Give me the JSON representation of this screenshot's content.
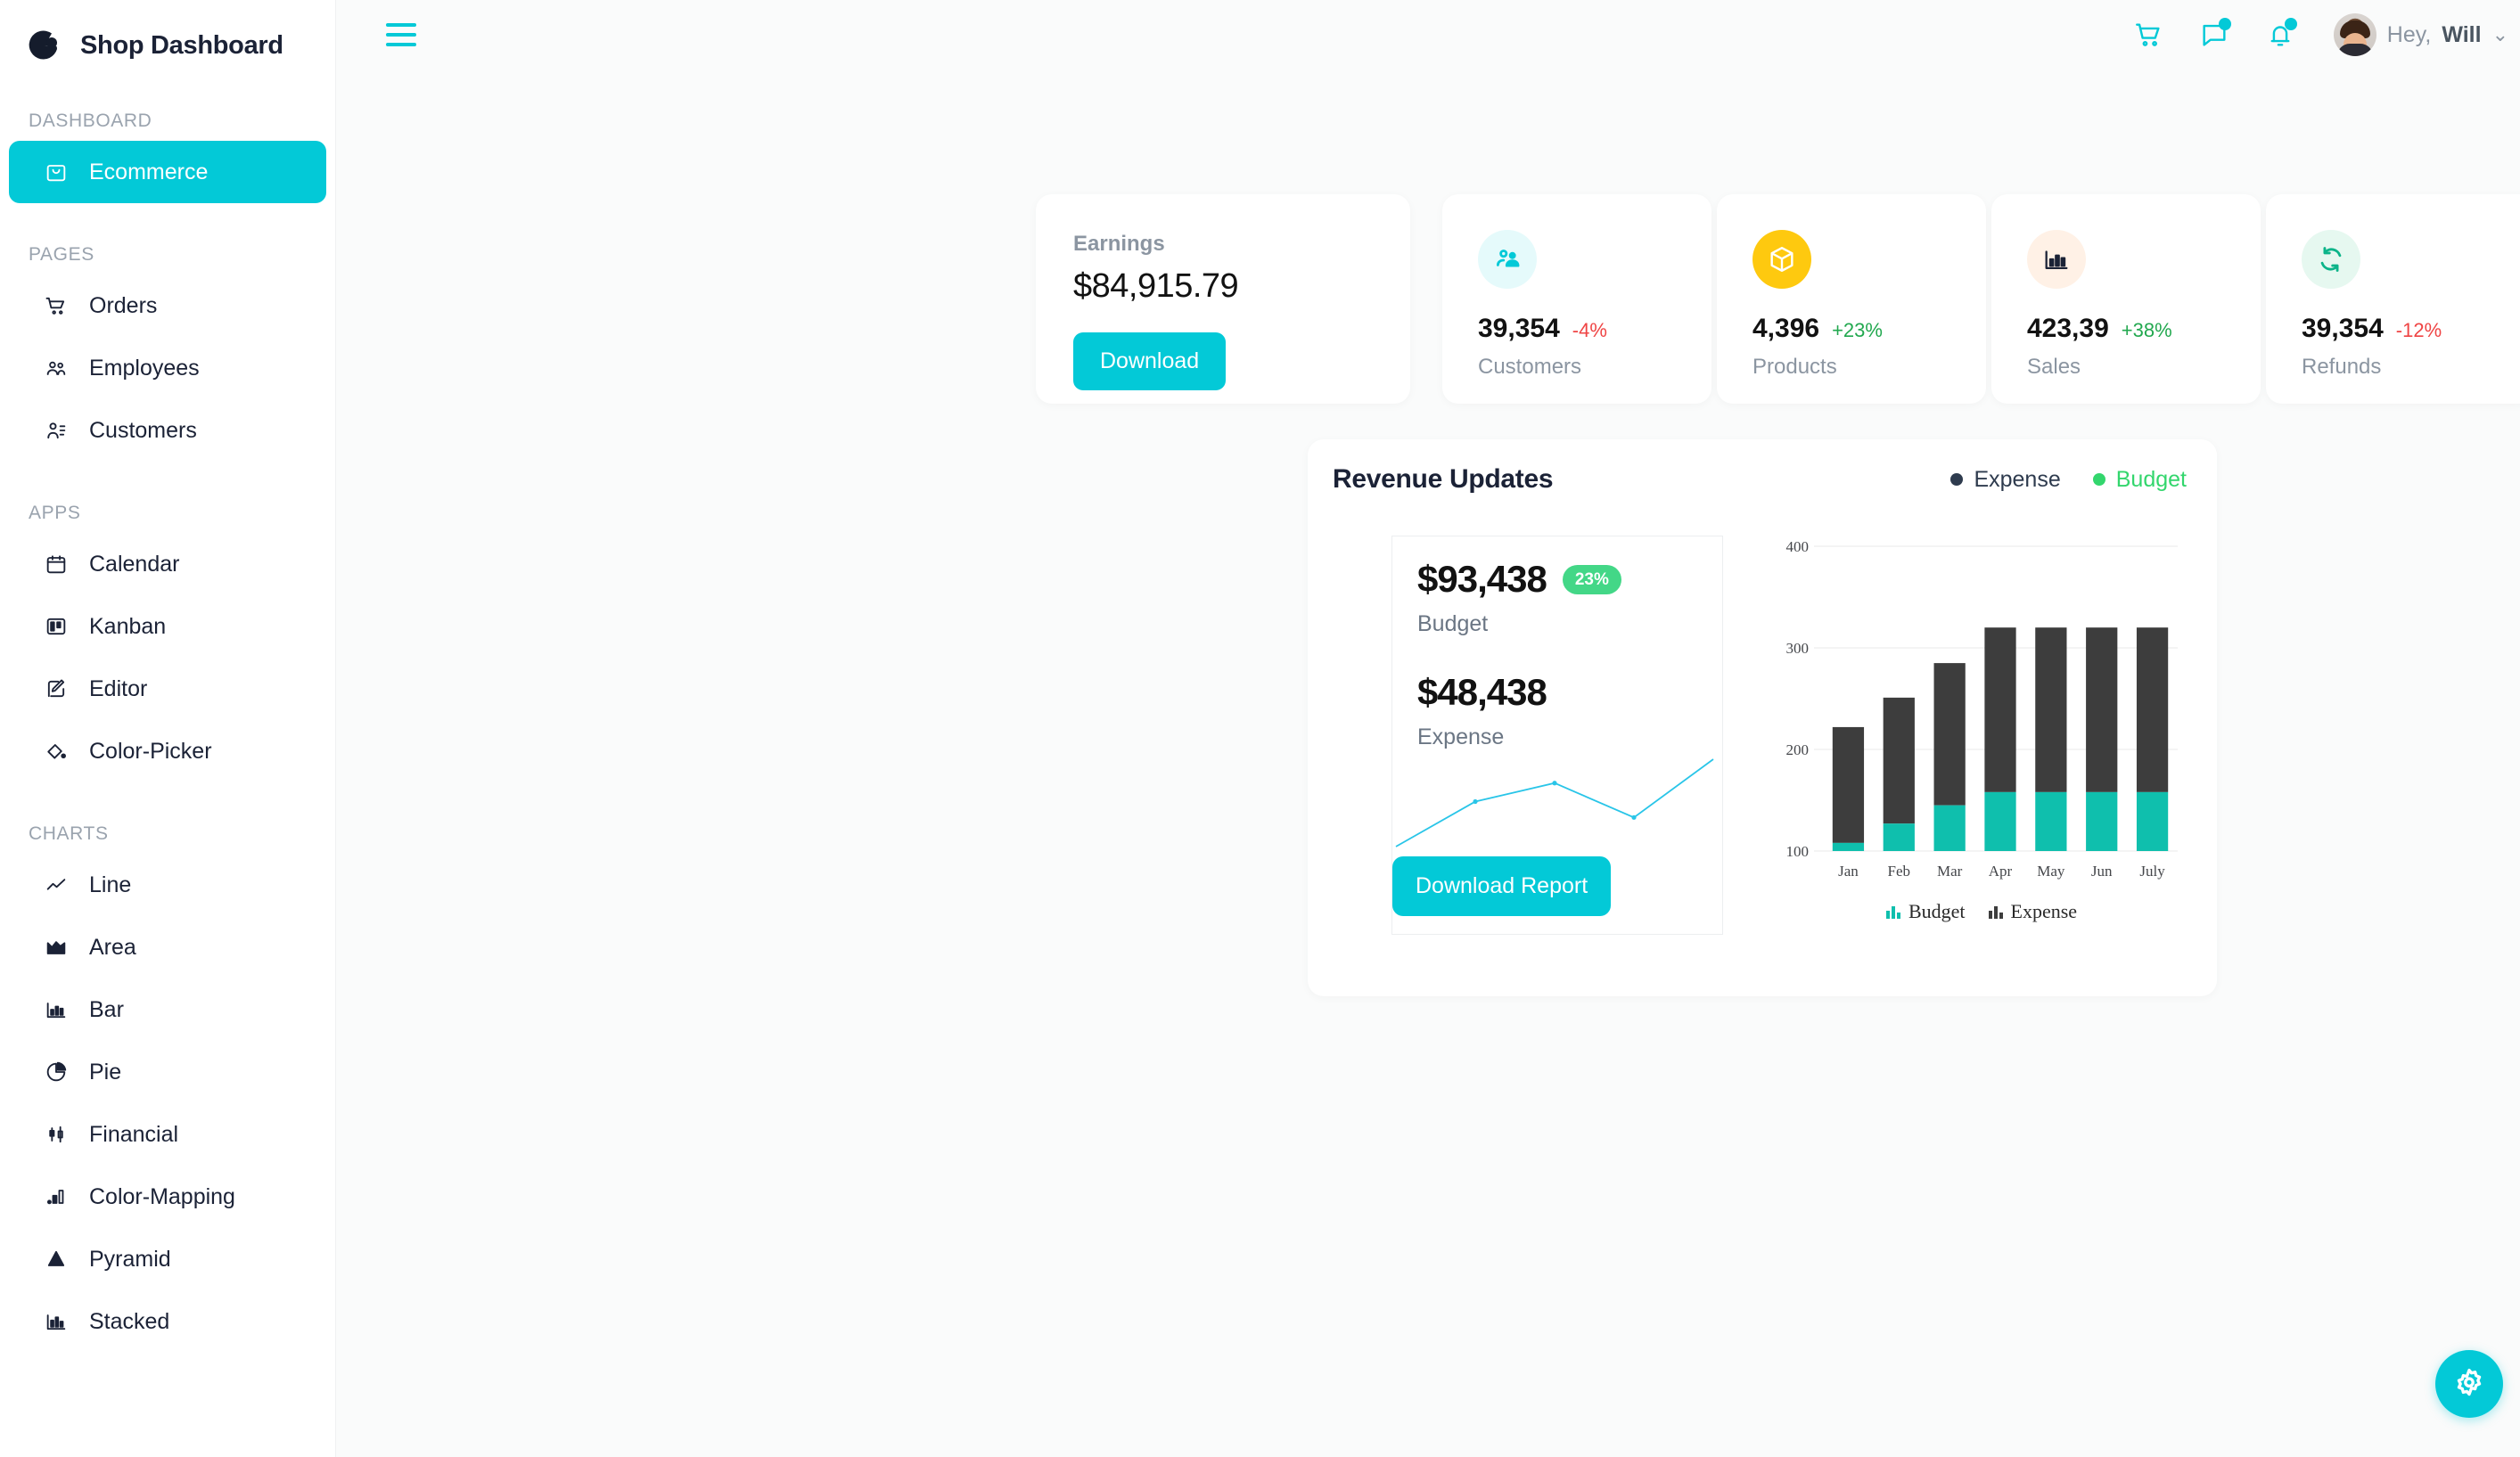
{
  "brand": {
    "title": "Shop Dashboard",
    "logo_icon": "shop-logo-icon"
  },
  "sidebar": {
    "sections": [
      {
        "label": "DASHBOARD",
        "items": [
          {
            "label": "Ecommerce",
            "icon": "shopping-bag-icon",
            "active": true
          }
        ]
      },
      {
        "label": "PAGES",
        "items": [
          {
            "label": "Orders",
            "icon": "shopping-cart-icon",
            "active": false
          },
          {
            "label": "Employees",
            "icon": "users-group-icon",
            "active": false
          },
          {
            "label": "Customers",
            "icon": "user-list-icon",
            "active": false
          }
        ]
      },
      {
        "label": "APPS",
        "items": [
          {
            "label": "Calendar",
            "icon": "calendar-icon",
            "active": false
          },
          {
            "label": "Kanban",
            "icon": "kanban-board-icon",
            "active": false
          },
          {
            "label": "Editor",
            "icon": "edit-pencil-icon",
            "active": false
          },
          {
            "label": "Color-Picker",
            "icon": "paint-bucket-icon",
            "active": false
          }
        ]
      },
      {
        "label": "CHARTS",
        "items": [
          {
            "label": "Line",
            "icon": "line-chart-icon",
            "active": false
          },
          {
            "label": "Area",
            "icon": "area-chart-icon",
            "active": false
          },
          {
            "label": "Bar",
            "icon": "bar-chart-icon",
            "active": false
          },
          {
            "label": "Pie",
            "icon": "pie-chart-icon",
            "active": false
          },
          {
            "label": "Financial",
            "icon": "financial-chart-icon",
            "active": false
          },
          {
            "label": "Color-Mapping",
            "icon": "color-mapping-icon",
            "active": false
          },
          {
            "label": "Pyramid",
            "icon": "pyramid-chart-icon",
            "active": false
          },
          {
            "label": "Stacked",
            "icon": "stacked-chart-icon",
            "active": false
          }
        ]
      }
    ]
  },
  "topbar": {
    "menu_icon": "hamburger-menu-icon",
    "cart_icon": "shopping-cart-icon",
    "chat_icon": "chat-bubble-icon",
    "notification_icon": "bell-icon",
    "greeting": "Hey,",
    "user_name": "Will",
    "chevron": "⌄"
  },
  "earnings": {
    "label": "Earnings",
    "value": "$84,915.79",
    "button": "Download"
  },
  "stats": [
    {
      "title": "Customers",
      "value": "39,354",
      "delta": "-4%",
      "delta_color": "#ef4444",
      "icon": "customers-icon",
      "icon_color": "#03c9d7",
      "icon_bg": "#e5fafb"
    },
    {
      "title": "Products",
      "value": "4,396",
      "delta": "+23%",
      "delta_color": "#22a84f",
      "icon": "package-box-icon",
      "icon_color": "#ffffff",
      "icon_bg": "#fec90f"
    },
    {
      "title": "Sales",
      "value": "423,39",
      "delta": "+38%",
      "delta_color": "#22a84f",
      "icon": "bar-chart-icon",
      "icon_color": "#f05252",
      "icon_bg": "#fff1e6"
    },
    {
      "title": "Refunds",
      "value": "39,354",
      "delta": "-12%",
      "delta_color": "#ef4444",
      "icon": "refresh-loop-icon",
      "icon_color": "#0bb489",
      "icon_bg": "#e6f8f0"
    }
  ],
  "revenue": {
    "title": "Revenue Updates",
    "legend": [
      {
        "label": "Expense",
        "color": "#2e3b4e"
      },
      {
        "label": "Budget",
        "color": "#33d66d"
      }
    ],
    "budget_amount": "$93,438",
    "budget_badge": "23%",
    "budget_label": "Budget",
    "expense_amount": "$48,438",
    "expense_label": "Expense",
    "report_button": "Download Report"
  },
  "fab": {
    "icon": "gear-settings-icon"
  },
  "colors": {
    "accent": "#03c9d7",
    "budget_bar": "#0fbfad",
    "expense_bar": "#3d3d3d",
    "green": "#33d66d",
    "red": "#ef4444",
    "text_dark": "#1b2236",
    "text_muted": "#8b95a1"
  },
  "chart_data": [
    {
      "type": "bar",
      "title": "Revenue Updates",
      "stacked": true,
      "categories": [
        "Jan",
        "Feb",
        "Mar",
        "Apr",
        "May",
        "Jun",
        "July"
      ],
      "series": [
        {
          "name": "Budget",
          "color": "#0fbfad",
          "values": [
            108,
            127,
            145,
            158,
            158,
            158,
            158
          ]
        },
        {
          "name": "Expense",
          "color": "#3d3d3d",
          "values": [
            222,
            251,
            285,
            320,
            320,
            320,
            320
          ]
        }
      ],
      "ylim": [
        100,
        400
      ],
      "yticks": [
        100,
        200,
        300,
        400
      ],
      "ytick_labels": [
        "100",
        "200",
        "300",
        "400"
      ],
      "xlabel": "",
      "ylabel": "",
      "grid": true,
      "legend": [
        "Budget",
        "Expense"
      ],
      "legend_position": "bottom"
    },
    {
      "type": "line",
      "title": "",
      "x": [
        1,
        2,
        3,
        4,
        5
      ],
      "values": [
        18,
        52,
        66,
        40,
        84
      ],
      "color": "#29c5e8",
      "grid": false,
      "markers": true
    }
  ]
}
